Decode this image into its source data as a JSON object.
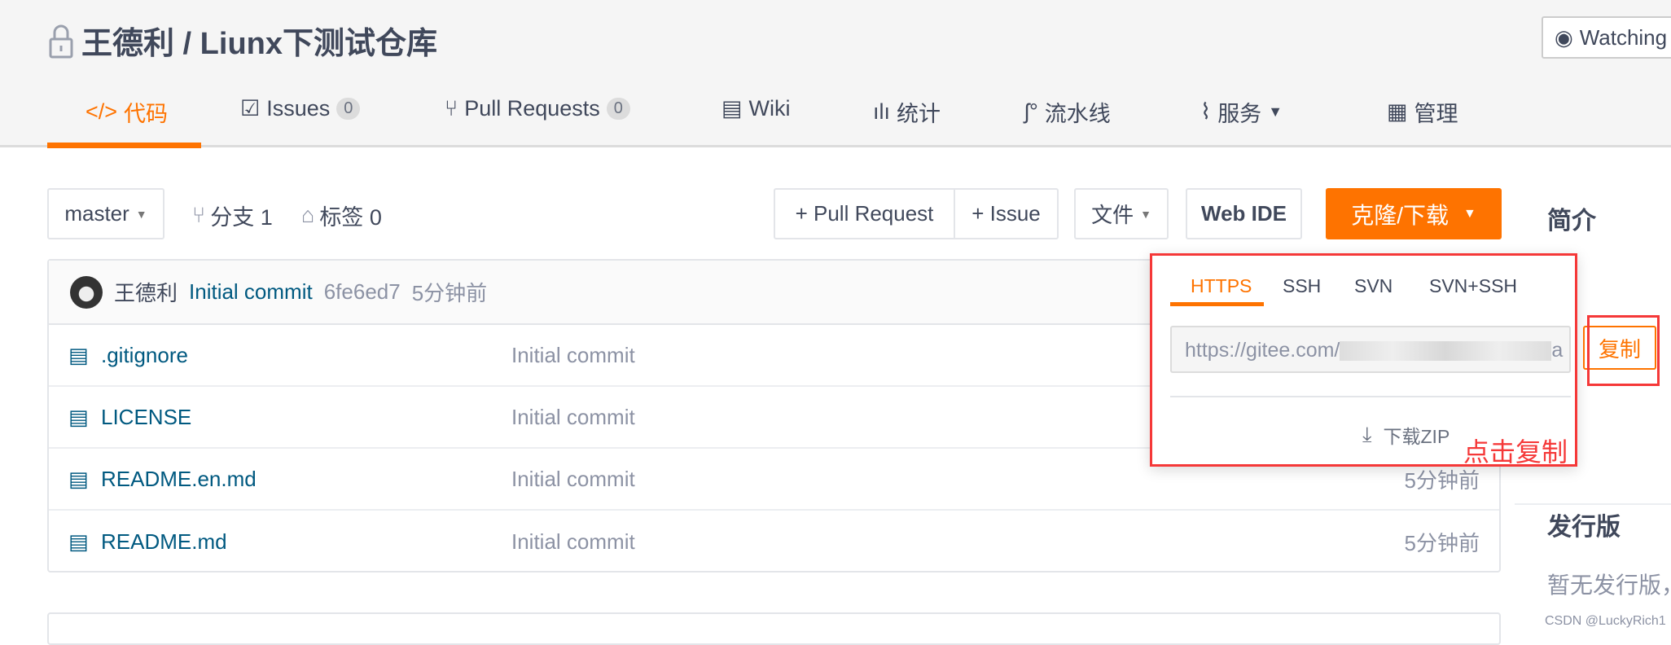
{
  "header": {
    "title": "王德利 / Liunx下测试仓库",
    "watch_label": "Watching",
    "tabs": [
      {
        "label": "代码"
      },
      {
        "label": "Issues",
        "count": "0"
      },
      {
        "label": "Pull Requests",
        "count": "0"
      },
      {
        "label": "Wiki"
      },
      {
        "label": "统计"
      },
      {
        "label": "流水线"
      },
      {
        "label": "服务"
      },
      {
        "label": "管理"
      }
    ]
  },
  "toolbar": {
    "branch": "master",
    "branches": "分支 1",
    "tags": "标签 0",
    "pull_request": "+ Pull Request",
    "issue": "+ Issue",
    "file": "文件",
    "web_ide": "Web IDE",
    "clone": "克隆/下载"
  },
  "commit": {
    "author": "王德利",
    "message": "Initial commit",
    "hash": "6fe6ed7",
    "time": "5分钟前"
  },
  "files": [
    {
      "name": ".gitignore",
      "message": "Initial commit",
      "time": ""
    },
    {
      "name": "LICENSE",
      "message": "Initial commit",
      "time": ""
    },
    {
      "name": "README.en.md",
      "message": "Initial commit",
      "time": "5分钟前"
    },
    {
      "name": "README.md",
      "message": "Initial commit",
      "time": "5分钟前"
    }
  ],
  "clone_popup": {
    "tabs": [
      "HTTPS",
      "SSH",
      "SVN",
      "SVN+SSH"
    ],
    "active_tab": "HTTPS",
    "url_prefix": "https://gitee.com/",
    "url_suffix": "a",
    "copy": "复制",
    "download_zip": "下载ZIP",
    "annotation": "点击复制",
    "accent": "#fe7300",
    "annotation_color": "#f53838"
  },
  "sidebar": {
    "intro": "简介",
    "releases": "发行版",
    "no_releases": "暂无发行版，"
  },
  "watermark": "CSDN @LuckyRich1"
}
